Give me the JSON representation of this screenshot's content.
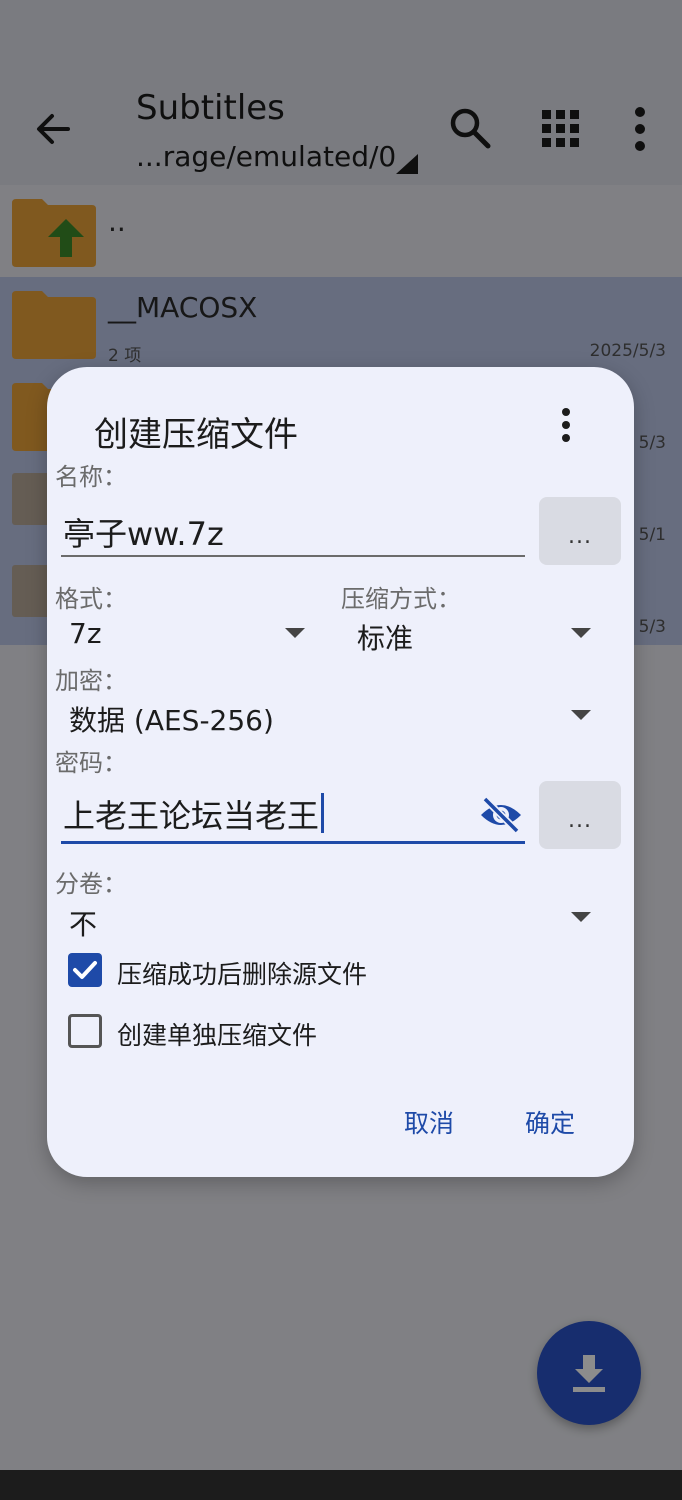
{
  "appbar": {
    "title": "Subtitles",
    "path": "...rage/emulated/0"
  },
  "files": [
    {
      "name": "..",
      "sub": "",
      "date": ""
    },
    {
      "name": "__MACOSX",
      "sub": "2 项",
      "date": "2025/5/3"
    },
    {
      "name": "",
      "sub": "",
      "date": "5/3"
    },
    {
      "name": "",
      "sub": "",
      "date": "5/1"
    },
    {
      "name": "",
      "sub": "",
      "date": "5/3"
    }
  ],
  "dialog": {
    "title": "创建压缩文件",
    "name_label": "名称：",
    "name_value": "亭子ww.7z",
    "browse_label": "...",
    "format_label": "格式：",
    "format_value": "7z",
    "method_label": "压缩方式：",
    "method_value": "标准",
    "encrypt_label": "加密：",
    "encrypt_value": "数据 (AES-256)",
    "password_label": "密码：",
    "password_value": "上老王论坛当老王",
    "split_label": "分卷：",
    "split_value": "不",
    "delete_source_label": "压缩成功后删除源文件",
    "delete_source_checked": true,
    "separate_label": "创建单独压缩文件",
    "separate_checked": false,
    "cancel": "取消",
    "ok": "确定"
  },
  "colors": {
    "accent": "#1e4aa8",
    "fab": "#2a52c8",
    "folder": "#e9a33a",
    "up_arrow": "#3c8a2a"
  }
}
